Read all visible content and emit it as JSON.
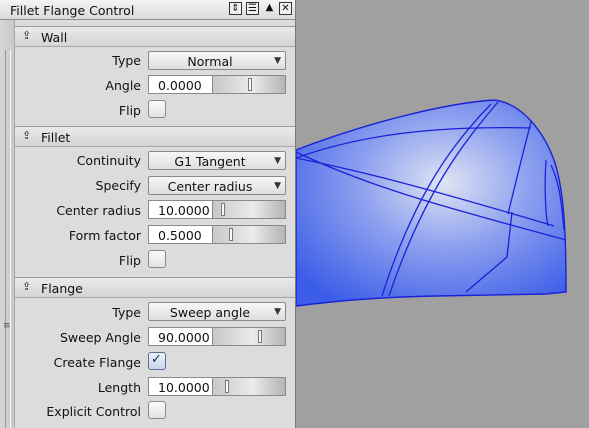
{
  "window": {
    "title": "Fillet Flange Control"
  },
  "titlebar_icons": [
    "dock-toggle-icon",
    "menu-list-icon",
    "collapse-up-icon",
    "close-x-icon"
  ],
  "sections": {
    "wall": {
      "header": "Wall",
      "type_label": "Type",
      "type_value": "Normal",
      "angle_label": "Angle",
      "angle_value": "0.0000",
      "flip_label": "Flip",
      "flip_checked": false
    },
    "fillet": {
      "header": "Fillet",
      "continuity_label": "Continuity",
      "continuity_value": "G1 Tangent",
      "specify_label": "Specify",
      "specify_value": "Center radius",
      "center_radius_label": "Center radius",
      "center_radius_value": "10.0000",
      "form_factor_label": "Form factor",
      "form_factor_value": "0.5000",
      "flip_label": "Flip",
      "flip_checked": false
    },
    "flange": {
      "header": "Flange",
      "type_label": "Type",
      "type_value": "Sweep angle",
      "sweep_angle_label": "Sweep Angle",
      "sweep_angle_value": "90.0000",
      "create_flange_label": "Create Flange",
      "create_flange_checked": true,
      "length_label": "Length",
      "length_value": "10.0000",
      "explicit_control_label": "Explicit Control",
      "explicit_control_checked": false
    }
  },
  "colors": {
    "panel": "#dcdcdc",
    "viewport": "#a0a0a0",
    "surface": "#4d6ef0",
    "surface_edge": "#1a1fd6"
  }
}
